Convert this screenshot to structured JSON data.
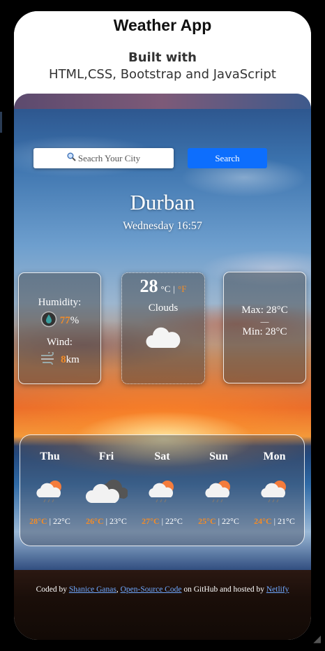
{
  "header": {
    "title": "Weather App",
    "built_with": "Built with",
    "tech": "HTML,CSS, Bootstrap and JavaScript"
  },
  "search": {
    "icon": "magnifier-icon",
    "placeholder": "Seacrh Your City",
    "button_label": "Search"
  },
  "current": {
    "city": "Durban",
    "datetime": "Wednesday 16:57",
    "humidity_label": "Humidity:",
    "humidity_value": "77",
    "humidity_unit": "%",
    "wind_label": "Wind:",
    "wind_value": "8",
    "wind_unit": "km",
    "temperature": "28",
    "unit_c": "°C",
    "unit_sep": "|",
    "unit_f": "°F",
    "condition": "Clouds",
    "max": "Max: 28°C",
    "divider": "—",
    "min": "Min: 28°C"
  },
  "forecast": [
    {
      "day": "Thu",
      "max": "28°C",
      "sep": "|",
      "min": "22°C",
      "icon": "sun-cloud-rain-icon"
    },
    {
      "day": "Fri",
      "max": "26°C",
      "sep": "|",
      "min": "23°C",
      "icon": "cloud-icon"
    },
    {
      "day": "Sat",
      "max": "27°C",
      "sep": "|",
      "min": "22°C",
      "icon": "sun-cloud-rain-icon"
    },
    {
      "day": "Sun",
      "max": "25°C",
      "sep": "|",
      "min": "22°C",
      "icon": "sun-cloud-rain-icon"
    },
    {
      "day": "Mon",
      "max": "24°C",
      "sep": "|",
      "min": "21°C",
      "icon": "sun-cloud-rain-icon"
    }
  ],
  "footer": {
    "coded_by": "Coded by ",
    "author": "Shanice Ganas",
    "comma": ", ",
    "source": "Open-Source Code",
    "on_github": " on GitHub and hosted by ",
    "host": "Netlify"
  },
  "colors": {
    "accent": "#f28c28",
    "button": "#0d6efd",
    "link": "#6fa8ff"
  }
}
